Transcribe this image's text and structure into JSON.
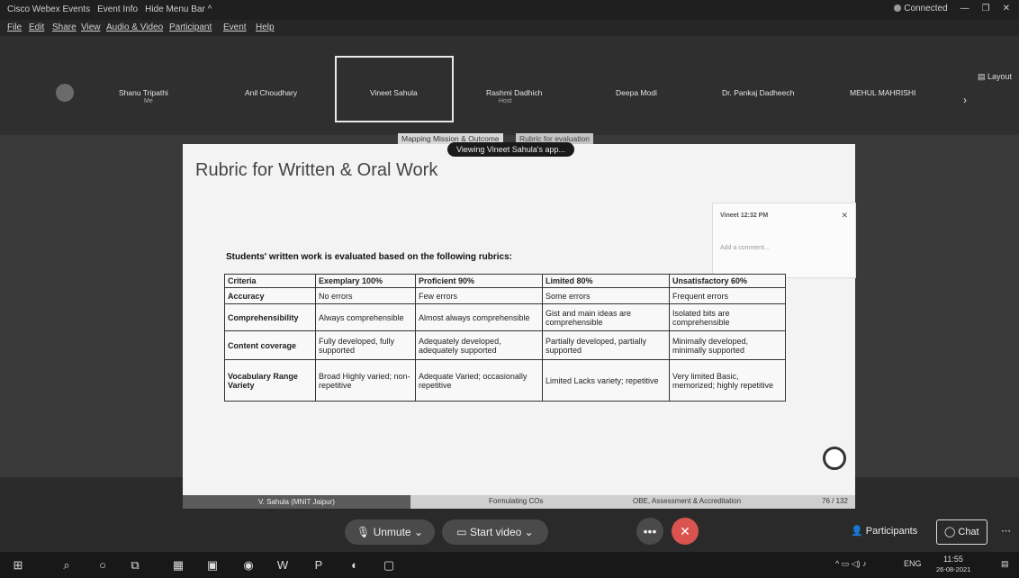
{
  "titlebar": {
    "app_title": "Cisco Webex Events",
    "event_info": "Event Info",
    "hide_menu": "Hide Menu Bar ^",
    "status": "Connected"
  },
  "menu": [
    "File",
    "Edit",
    "Share",
    "View",
    "Audio & Video",
    "Participant",
    "Event",
    "Help"
  ],
  "participants": [
    {
      "name": "Shanu Tripathi",
      "sub": "Me"
    },
    {
      "name": "Anil Choudhary",
      "sub": ""
    },
    {
      "name": "Vineet Sahula",
      "sub": ""
    },
    {
      "name": "Rashmi Dadhich",
      "sub": "Host"
    },
    {
      "name": "Deepa Modi",
      "sub": ""
    },
    {
      "name": "Dr. Pankaj Dadheech",
      "sub": ""
    },
    {
      "name": "MEHUL MAHRISHI",
      "sub": ""
    }
  ],
  "layout_label": "Layout",
  "share": {
    "tab1": "Mapping Mission & Outcome",
    "tab2": "Rubric for evaluation",
    "viewing": "Viewing Vineet Sahula's app..."
  },
  "slide": {
    "title": "Rubric for Written & Oral Work",
    "subtitle": "Students' written work is evaluated based on the following rubrics:",
    "comment": {
      "author": "Vineet 12:32 PM",
      "placeholder": "Add a comment..."
    },
    "table": {
      "headers": [
        "Criteria",
        "Exemplary 100%",
        "Proficient 90%",
        "Limited 80%",
        "Unsatisfactory 60%"
      ],
      "rows": [
        [
          "Accuracy",
          "No errors",
          "Few errors",
          "Some errors",
          "Frequent errors"
        ],
        [
          "Comprehensibility",
          "Always comprehensible",
          "Almost always comprehensible",
          "Gist and main ideas are comprehensible",
          "Isolated bits are comprehensible"
        ],
        [
          "Content coverage",
          "Fully developed, fully supported",
          "Adequately developed, adequately supported",
          "Partially developed, partially supported",
          "Minimally developed, minimally supported"
        ],
        [
          "Vocabulary Range Variety",
          "Broad Highly varied; non-repetitive",
          "Adequate Varied; occasionally repetitive",
          "Limited Lacks variety; repetitive",
          "Very limited Basic, memorized; highly repetitive"
        ]
      ]
    }
  },
  "footer": {
    "presenter": "V. Sahula (MNIT Jaipur)",
    "topic": "Formulating COs",
    "course": "OBE, Assessment & Accreditation",
    "page": "76 / 132"
  },
  "controls": {
    "unmute": "Unmute",
    "start_video": "Start video",
    "participants": "Participants",
    "chat": "Chat"
  },
  "tray": {
    "lang": "ENG",
    "time": "11:55",
    "date": "26-08-2021"
  }
}
